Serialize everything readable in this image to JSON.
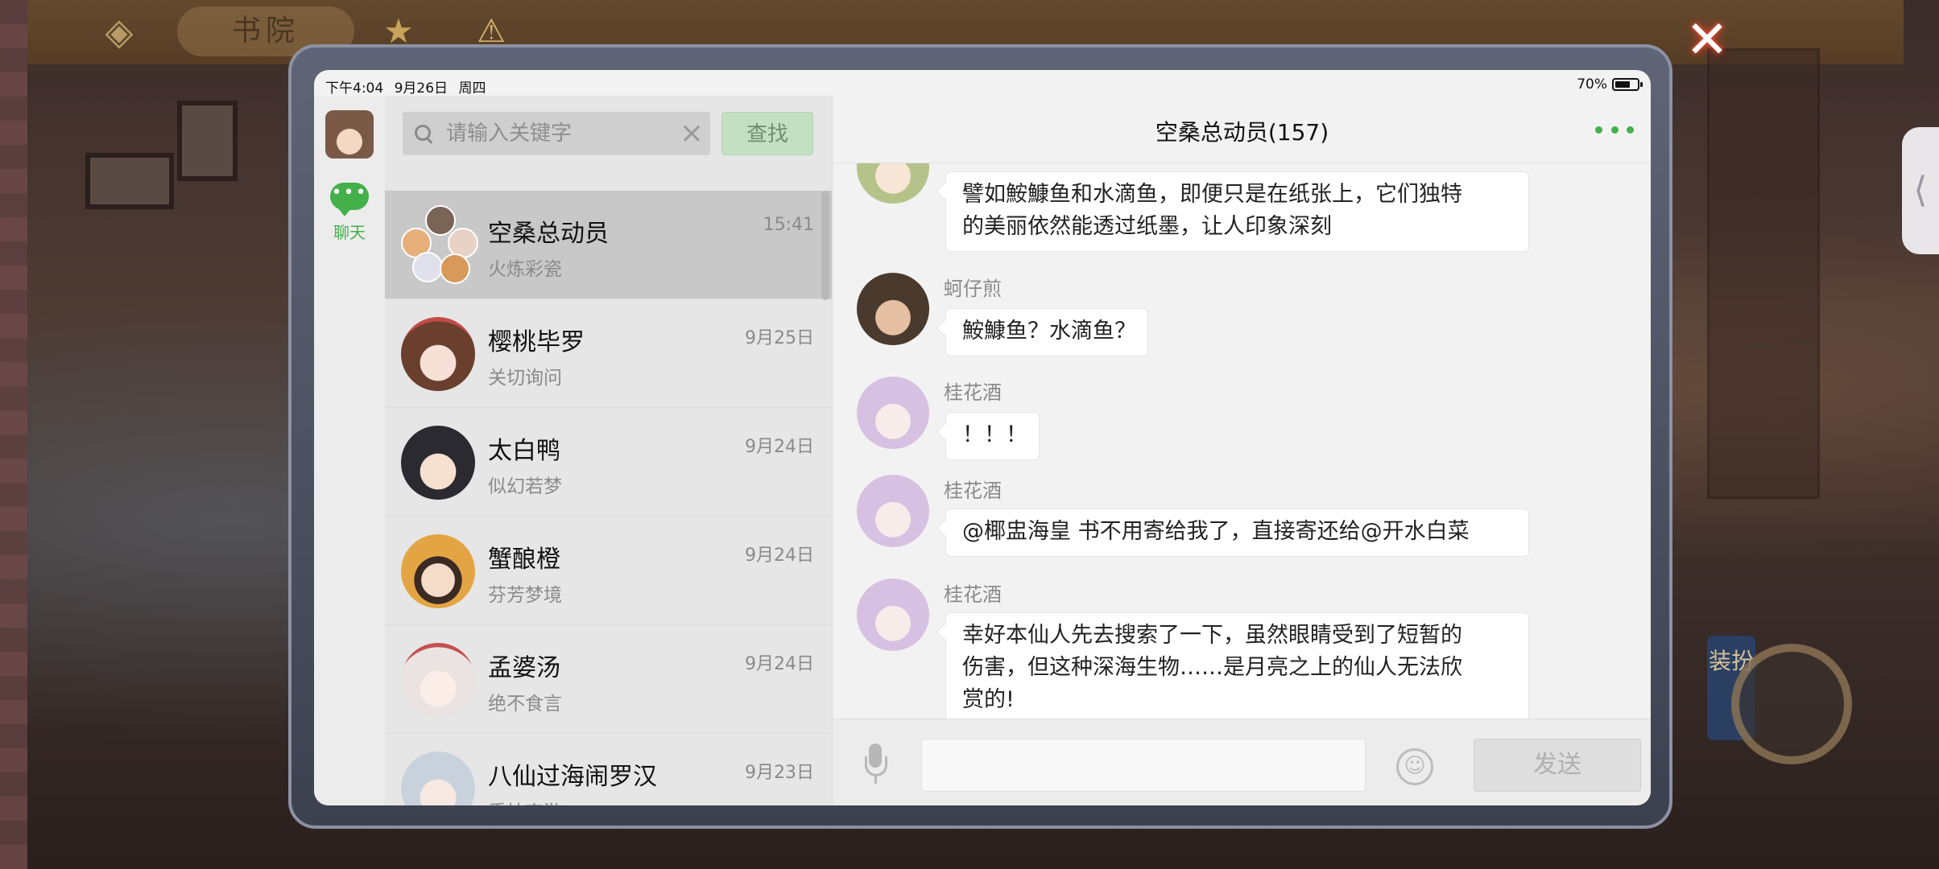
{
  "background": {
    "title": "书院",
    "dress_label": "装扮"
  },
  "status": {
    "time": "下午4:04",
    "date": "9月26日",
    "weekday": "周四",
    "battery": "70%",
    "battery_level": 0.7
  },
  "rail": {
    "chat_label": "聊天"
  },
  "search": {
    "placeholder": "请输入关键字",
    "button_label": "查找"
  },
  "conversations": [
    {
      "name": "空桑总动员",
      "subtitle": "火炼彩瓷",
      "time": "15:41",
      "active": true
    },
    {
      "name": "樱桃毕罗",
      "subtitle": "关切询问",
      "time": "9月25日"
    },
    {
      "name": "太白鸭",
      "subtitle": "似幻若梦",
      "time": "9月24日"
    },
    {
      "name": "蟹酿橙",
      "subtitle": "芬芳梦境",
      "time": "9月24日"
    },
    {
      "name": "孟婆汤",
      "subtitle": "绝不食言",
      "time": "9月24日"
    },
    {
      "name": "八仙过海闹罗汉",
      "subtitle": "秉烛夜游",
      "time": "9月23日"
    }
  ],
  "chat": {
    "title": "空桑总动员(157)",
    "messages": [
      {
        "sender": "",
        "lines": [
          "譬如鮟鱇鱼和水滴鱼，即便只是在纸张上，它们独特",
          "的美丽依然能透过纸墨，让人印象深刻"
        ]
      },
      {
        "sender": "蚵仔煎",
        "lines": [
          "鮟鱇鱼？水滴鱼？"
        ]
      },
      {
        "sender": "桂花酒",
        "lines": [
          "！！！"
        ]
      },
      {
        "sender": "桂花酒",
        "lines": [
          "@椰盅海皇 书不用寄给我了，直接寄还给@开水白菜"
        ]
      },
      {
        "sender": "桂花酒",
        "lines": [
          "幸好本仙人先去搜索了一下，虽然眼睛受到了短暂的",
          "伤害，但这种深海生物……是月亮之上的仙人无法欣",
          "赏的!"
        ]
      }
    ],
    "send_label": "发送"
  }
}
